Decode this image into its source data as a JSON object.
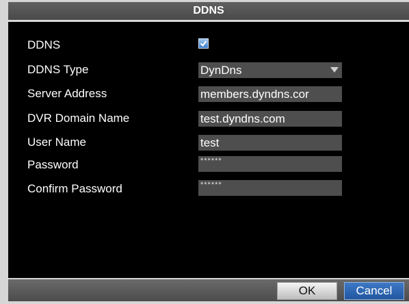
{
  "dialog": {
    "title": "DDNS",
    "fields": [
      {
        "label": "DDNS",
        "type": "checkbox",
        "checked": true
      },
      {
        "label": "DDNS Type",
        "type": "dropdown",
        "value": "DynDns"
      },
      {
        "label": "Server Address",
        "type": "text",
        "value": "members.dyndns.cor"
      },
      {
        "label": "DVR Domain Name",
        "type": "text",
        "value": "test.dyndns.com"
      },
      {
        "label": "User Name",
        "type": "text",
        "value": "test"
      },
      {
        "label": "Password",
        "type": "password",
        "value": "******"
      },
      {
        "label": "Confirm Password",
        "type": "password",
        "value": "******"
      }
    ],
    "buttons": {
      "ok": "OK",
      "cancel": "Cancel"
    }
  },
  "colors": {
    "title_bar": "#4a4a4a",
    "panel_background": "#000000",
    "field_background": "#4e4e4e",
    "cancel_button": "#22579f",
    "ok_button": "#d0d0d0"
  },
  "icons": {
    "checkbox": "check-icon",
    "dropdown": "chevron-down-icon"
  }
}
